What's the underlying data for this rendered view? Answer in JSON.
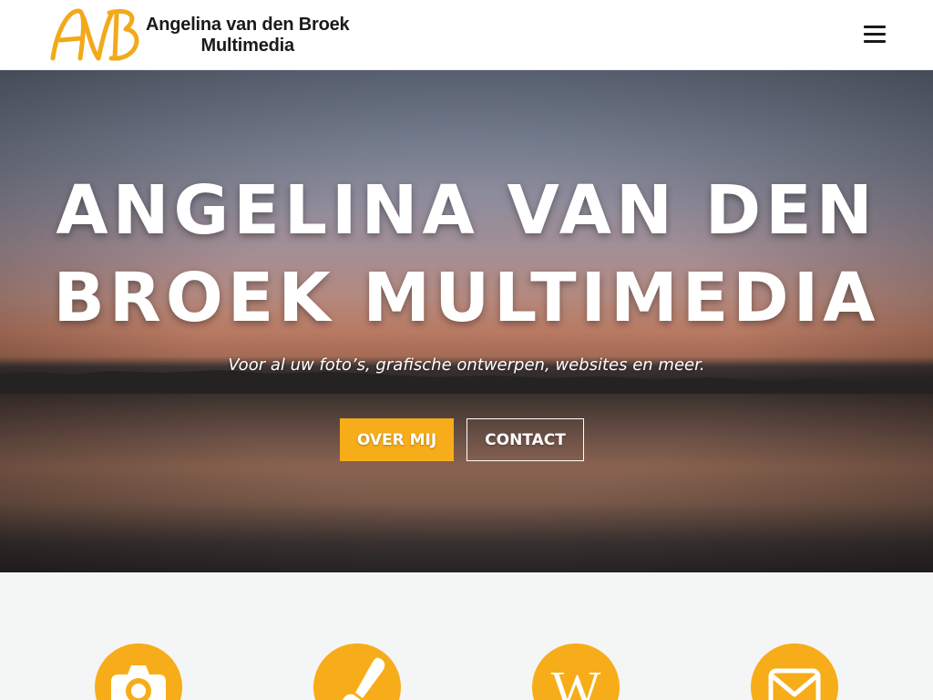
{
  "header": {
    "logo_line1": "Angelina van den Broek",
    "logo_line2": "Multimedia",
    "logo_monogram": "AvB",
    "menu_icon": "hamburger-menu-icon"
  },
  "hero": {
    "title": "Angelina van den Broek Multimedia",
    "subtitle": "Voor al uw foto’s, grafische ontwerpen, websites en meer.",
    "primary_button": "Over mij",
    "secondary_button": "Contact"
  },
  "services": [
    {
      "icon": "camera-icon"
    },
    {
      "icon": "paintbrush-icon"
    },
    {
      "icon": "wikipedia-w-icon",
      "glyph": "W"
    },
    {
      "icon": "envelope-icon"
    }
  ],
  "colors": {
    "accent": "#f7ad19",
    "header_bg": "#ffffff",
    "section_bg": "#f4f5f5",
    "text_dark": "#1a1a1a"
  }
}
